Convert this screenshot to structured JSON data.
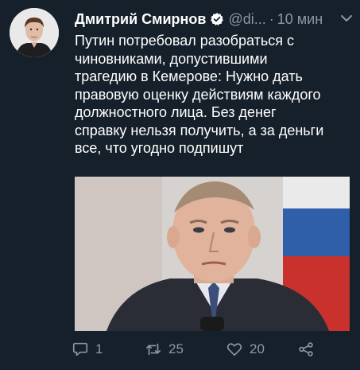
{
  "tweet": {
    "author_name": "Дмитрий Смирнов",
    "handle": "@di...",
    "separator": "·",
    "time": "10 мин",
    "text_lines": [
      "Путин потребовал разобраться с",
      "чиновниками, допустившими",
      "трагедию в Кемерове: Нужно дать",
      "правовую оценку действиям каждого",
      "должностного лица. Без денег",
      "справку нельзя получить, а за деньги",
      "все, что угодно подпишут"
    ]
  },
  "actions": {
    "reply_count": "1",
    "retweet_count": "25",
    "like_count": "20"
  },
  "icons": {
    "reply": "reply-icon",
    "retweet": "retweet-icon",
    "like": "heart-icon",
    "share": "share-icon",
    "verified": "verified-badge-icon",
    "more": "chevron-down-icon"
  },
  "colors": {
    "background": "#15202b",
    "text": "#ffffff",
    "muted": "#8899a6",
    "verified": "#ffffff"
  }
}
